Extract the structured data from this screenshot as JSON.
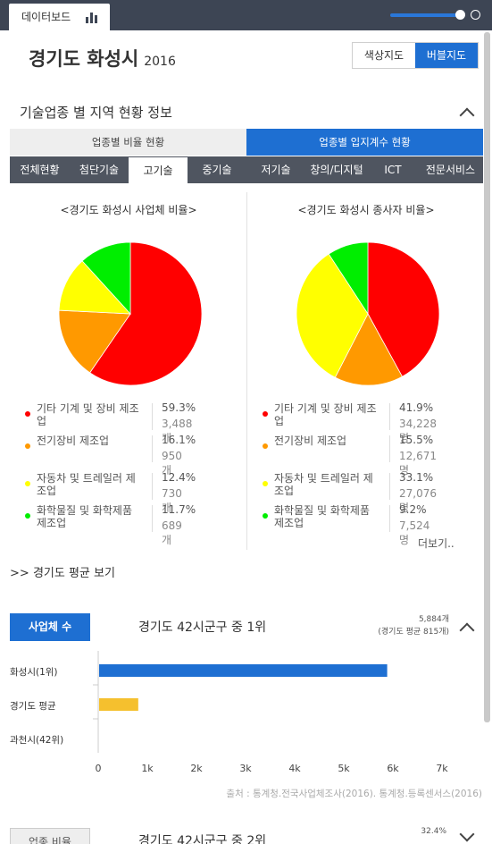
{
  "topbar": {
    "tab_label": "데이터보드"
  },
  "header": {
    "title": "경기도 화성시",
    "year": "2016",
    "map_modes": [
      "색상지도",
      "버블지도"
    ],
    "active_map_mode": 1
  },
  "section": {
    "title": "기술업종 별 지역 현황 정보"
  },
  "view_tabs": [
    "업종별 비율 현황",
    "업종별 입지계수 현황"
  ],
  "category_tabs": [
    "전체현황",
    "첨단기술",
    "고기술",
    "중기술",
    "저기술",
    "창의/디지털",
    "ICT",
    "전문서비스"
  ],
  "selected_category": 2,
  "colors": {
    "accent": "#1e6fd2",
    "bar_avg": "#f5c02e",
    "red": "#ff0000",
    "orange": "#ff9900",
    "yellow": "#ffff00",
    "green": "#00ee00"
  },
  "pies": [
    {
      "title": "<경기도 화성시 사업체 비율>",
      "items": [
        {
          "name": "기타 기계 및 장비 제조업",
          "pct": "59.3%",
          "count": "3,488개",
          "value": 59.3,
          "color": "#ff0000"
        },
        {
          "name": "전기장비 제조업",
          "pct": "16.1%",
          "count": "950개",
          "value": 16.1,
          "color": "#ff9900"
        },
        {
          "name": "자동차 및 트레일러 제조업",
          "pct": "12.4%",
          "count": "730개",
          "value": 12.4,
          "color": "#ffff00"
        },
        {
          "name": "화학물질 및 화학제품 제조업",
          "pct": "11.7%",
          "count": "689개",
          "value": 11.7,
          "color": "#00ee00"
        }
      ]
    },
    {
      "title": "<경기도 화성시 종사자 비율>",
      "items": [
        {
          "name": "기타 기계 및 장비 제조업",
          "pct": "41.9%",
          "count": "34,228명",
          "value": 41.9,
          "color": "#ff0000"
        },
        {
          "name": "전기장비 제조업",
          "pct": "15.5%",
          "count": "12,671명",
          "value": 15.5,
          "color": "#ff9900"
        },
        {
          "name": "자동차 및 트레일러 제조업",
          "pct": "33.1%",
          "count": "27,076명",
          "value": 33.1,
          "color": "#ffff00"
        },
        {
          "name": "화학물질 및 화학제품 제조업",
          "pct": "9.2%",
          "count": "7,524명",
          "value": 9.2,
          "color": "#00ee00"
        }
      ]
    }
  ],
  "more_label": "더보기..",
  "avg_link": "경기도 평균 보기",
  "rank1": {
    "button": "사업체 수",
    "title": "경기도 42시군구 중 1위",
    "value": "5,884개",
    "avg_note": "(경기도 평균 815개)"
  },
  "chart_data": {
    "type": "bar",
    "orientation": "horizontal",
    "categories": [
      "화성시(1위)",
      "경기도 평균",
      "과천시(42위)"
    ],
    "values": [
      5884,
      815,
      0
    ],
    "xlim": [
      0,
      7000
    ],
    "xticks": [
      "0",
      "1k",
      "2k",
      "3k",
      "4k",
      "5k",
      "6k",
      "7k"
    ],
    "colors": [
      "#1e6fd2",
      "#f5c02e",
      "#1e6fd2"
    ]
  },
  "source": "출처 : 통계청.전국사업체조사(2016). 통계청.등록센서스(2016)",
  "rank2": {
    "button": "업종 비율",
    "title": "경기도 42시군구 중 2위",
    "value": "32.4%"
  }
}
